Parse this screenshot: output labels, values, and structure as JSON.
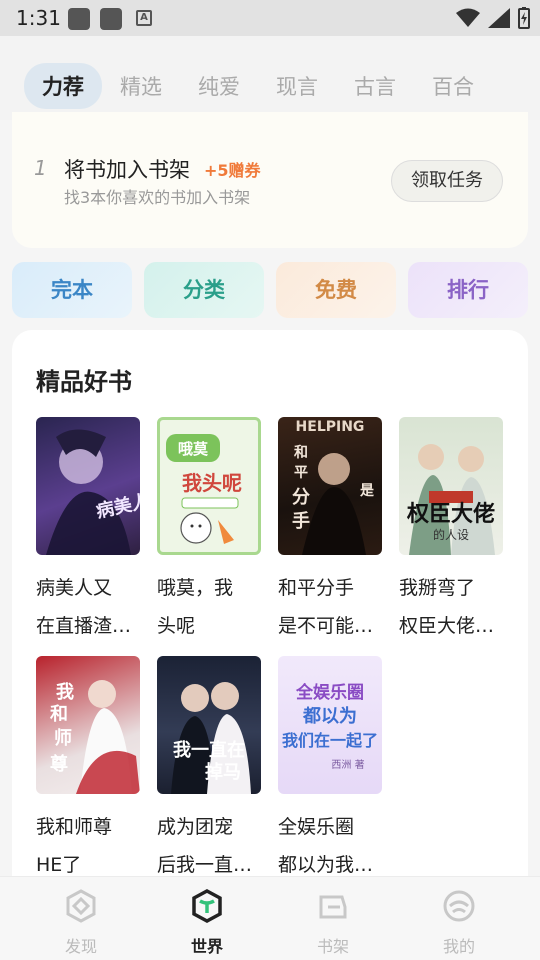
{
  "status_bar": {
    "time": "1:31"
  },
  "header": {
    "tabs": [
      {
        "label": "力荐",
        "active": true
      },
      {
        "label": "精选"
      },
      {
        "label": "纯爱"
      },
      {
        "label": "现言"
      },
      {
        "label": "古言"
      },
      {
        "label": "百合"
      }
    ]
  },
  "task": {
    "number": "1",
    "title": "将书加入书架",
    "bonus": "+5赠券",
    "description": "找3本你喜欢的书加入书架",
    "button_label": "领取任务"
  },
  "quick_entries": [
    "完本",
    "分类",
    "免费",
    "排行"
  ],
  "section": {
    "title": "精品好书",
    "books": [
      {
        "title_line1": "病美人又",
        "title_line2": "在直播渣…",
        "cover_text": "病美人"
      },
      {
        "title_line1": "哦莫，我",
        "title_line2": "头呢",
        "cover_text": "哦莫我头呢"
      },
      {
        "title_line1": "和平分手",
        "title_line2": "是不可能…",
        "cover_text": "和平分手"
      },
      {
        "title_line1": "我掰弯了",
        "title_line2": "权臣大佬…",
        "cover_text": "权臣大佬"
      },
      {
        "title_line1": "我和师尊",
        "title_line2": "HE了",
        "cover_text": "我和师尊"
      },
      {
        "title_line1": "成为团宠",
        "title_line2": "后我一直…",
        "cover_text": "我一直在掉马"
      },
      {
        "title_line1": "全娱乐圈",
        "title_line2": "都以为我…",
        "cover_text": "全娱乐圈都以为"
      }
    ]
  },
  "bottom_nav": {
    "items": [
      {
        "label": "发现",
        "icon": "discover-icon"
      },
      {
        "label": "世界",
        "icon": "world-icon",
        "active": true
      },
      {
        "label": "书架",
        "icon": "bookshelf-icon"
      },
      {
        "label": "我的",
        "icon": "profile-icon"
      }
    ]
  }
}
